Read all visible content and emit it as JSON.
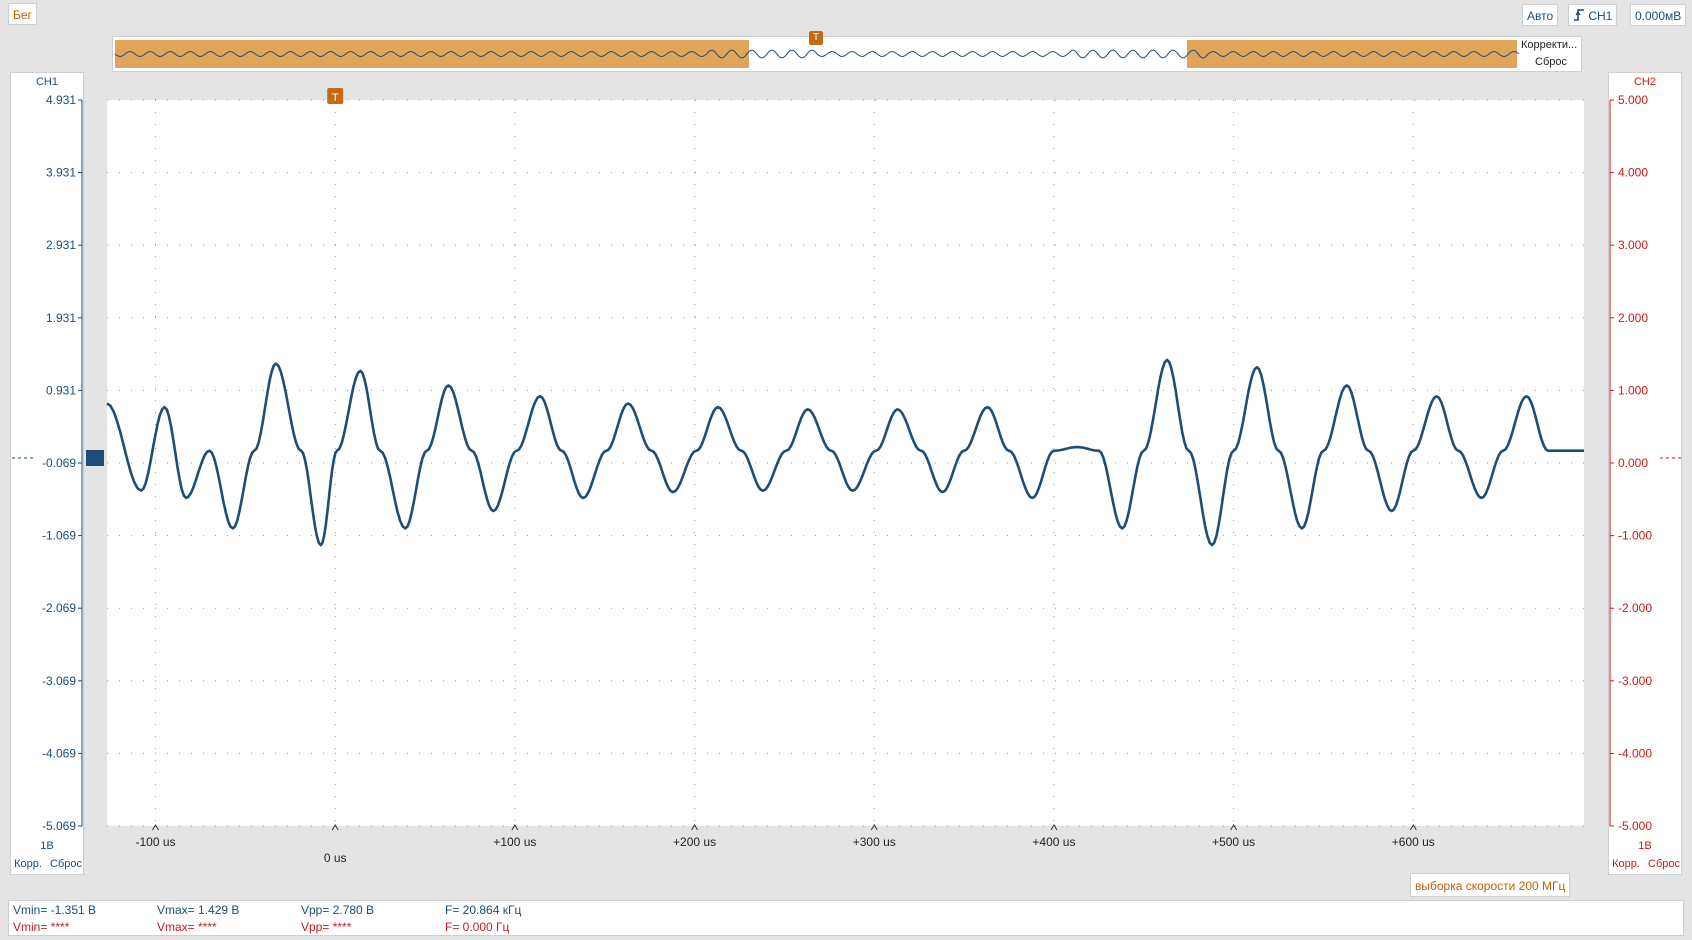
{
  "toolbar": {
    "run_state": "Бег",
    "trigger_mode": "Авто",
    "trigger_source": "CH1",
    "trigger_level": "0.000мВ"
  },
  "overview": {
    "correct_label": "Корректи...",
    "reset_label": "Сброс",
    "trigger_marker": "T"
  },
  "ch1": {
    "name": "CH1",
    "scale": "1В",
    "corr_label": "Корр.",
    "reset_label": "Сброс",
    "color": "#1e4d78",
    "ticks": [
      "4.931",
      "3.931",
      "2.931",
      "1.931",
      "0.931",
      "-0.069",
      "-1.069",
      "-2.069",
      "-3.069",
      "-4.069",
      "-5.069"
    ]
  },
  "ch2": {
    "name": "CH2",
    "scale": "1В",
    "corr_label": "Корр.",
    "reset_label": "Сброс",
    "color": "#cc1a1a",
    "ticks": [
      "5.000",
      "4.000",
      "3.000",
      "2.000",
      "1.000",
      "0.000",
      "-1.000",
      "-2.000",
      "-3.000",
      "-4.000",
      "-5.000"
    ]
  },
  "trigger_marker": "T",
  "x_ticks": [
    "-100 us",
    "0 us",
    "+100 us",
    "+200 us",
    "+300 us",
    "+400 us",
    "+500 us",
    "+600 us"
  ],
  "sample_rate": "выборка скорости 200 МГц",
  "measurements": {
    "ch1": {
      "vmin": "Vmin= -1.351 В",
      "vmax": "Vmax= 1.429 В",
      "vpp": "Vpp= 2.780 В",
      "freq": "F= 20.864 кГц"
    },
    "ch2": {
      "vmin": "Vmin= ****",
      "vmax": "Vmax= ****",
      "vpp": "Vpp= ****",
      "freq": "F= 0.000 Гц"
    }
  },
  "colors": {
    "accent": "#e0a45a",
    "trace": "#1e4d78",
    "ch2": "#cc1a1a",
    "run": "#c06000"
  },
  "chart_data": {
    "type": "line",
    "xlabel": "",
    "ylabel": "",
    "xlim": [
      -127,
      695
    ],
    "ylim": [
      -5.069,
      4.931
    ],
    "x_ticks": [
      -100,
      0,
      100,
      200,
      300,
      400,
      500,
      600
    ],
    "grid": true,
    "series": [
      {
        "x": [
          -127,
          -108,
          -95,
          -83,
          -70,
          -57,
          -45,
          -33,
          -19,
          -8,
          1,
          14,
          25,
          39,
          51,
          63,
          76,
          88,
          101,
          114,
          126,
          138,
          151,
          163,
          176,
          188,
          201,
          213,
          226,
          238,
          251,
          263,
          276,
          288,
          301,
          313,
          326,
          338,
          350,
          363,
          375,
          388,
          400,
          413,
          425,
          438,
          450,
          463,
          475,
          488,
          500,
          513,
          525,
          538,
          550,
          563,
          575,
          588,
          600,
          613,
          625,
          638,
          650,
          663,
          675,
          688,
          695
        ],
        "y": [
          0.75,
          -0.45,
          0.7,
          -0.55,
          0.1,
          -0.97,
          0.1,
          1.3,
          0.1,
          -1.2,
          0.1,
          1.2,
          0.1,
          -0.97,
          0.1,
          1.0,
          0.1,
          -0.73,
          0.1,
          0.85,
          0.1,
          -0.55,
          0.1,
          0.75,
          0.1,
          -0.47,
          0.1,
          0.7,
          0.1,
          -0.45,
          0.1,
          0.67,
          0.1,
          -0.45,
          0.1,
          0.67,
          0.1,
          -0.47,
          0.1,
          0.7,
          0.1,
          -0.55,
          0.1,
          0.15,
          0.1,
          -0.97,
          0.1,
          1.35,
          0.1,
          -1.2,
          0.1,
          1.25,
          0.1,
          -0.97,
          0.1,
          1.0,
          0.1,
          -0.73,
          0.1,
          0.85,
          0.1,
          -0.55,
          0.1,
          0.85,
          0.1,
          0.1,
          0.1
        ]
      }
    ]
  }
}
